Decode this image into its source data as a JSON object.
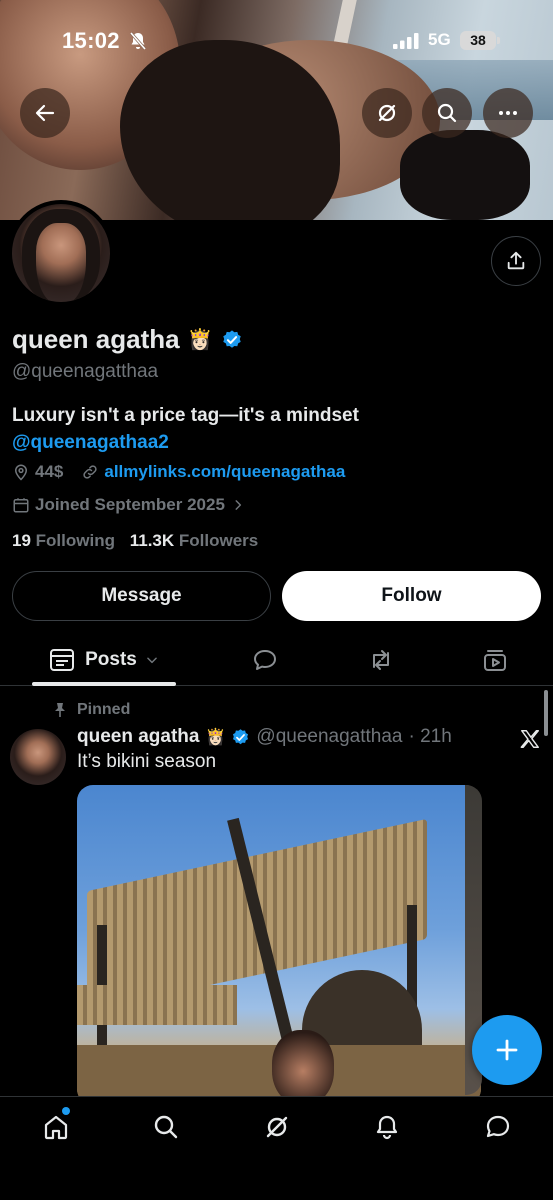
{
  "status_bar": {
    "time": "15:02",
    "network": "5G",
    "battery": "38"
  },
  "header": {
    "back_icon": "arrow-left-icon",
    "grok_icon": "grok-icon",
    "search_icon": "search-icon",
    "more_icon": "more-icon"
  },
  "profile": {
    "name": "queen agatha",
    "name_emoji": "👸🏻",
    "handle": "@queenagatthaa",
    "bio_line1": "Luxury isn't a price tag—it's a mindset",
    "bio_link": "@queenagathaa2",
    "location": "44$",
    "website": "allmylinks.com/queenagathaa",
    "joined": "Joined September 2025",
    "following_count": "19",
    "following_label": "Following",
    "followers_count": "11.3K",
    "followers_label": "Followers"
  },
  "actions": {
    "message_label": "Message",
    "follow_label": "Follow"
  },
  "tabs": {
    "posts_label": "Posts",
    "items": [
      "posts",
      "replies",
      "reposts",
      "media"
    ]
  },
  "post": {
    "pinned_label": "Pinned",
    "author": "queen agatha",
    "author_emoji": "👸🏻",
    "handle": "@queenagatthaa",
    "time": "· 21h",
    "text": "It’s bikini season"
  },
  "bottom_nav": [
    "home",
    "search",
    "grok",
    "notifications",
    "messages"
  ],
  "colors": {
    "accent": "#1d9bf0",
    "background": "#000000",
    "muted": "#71767b"
  }
}
